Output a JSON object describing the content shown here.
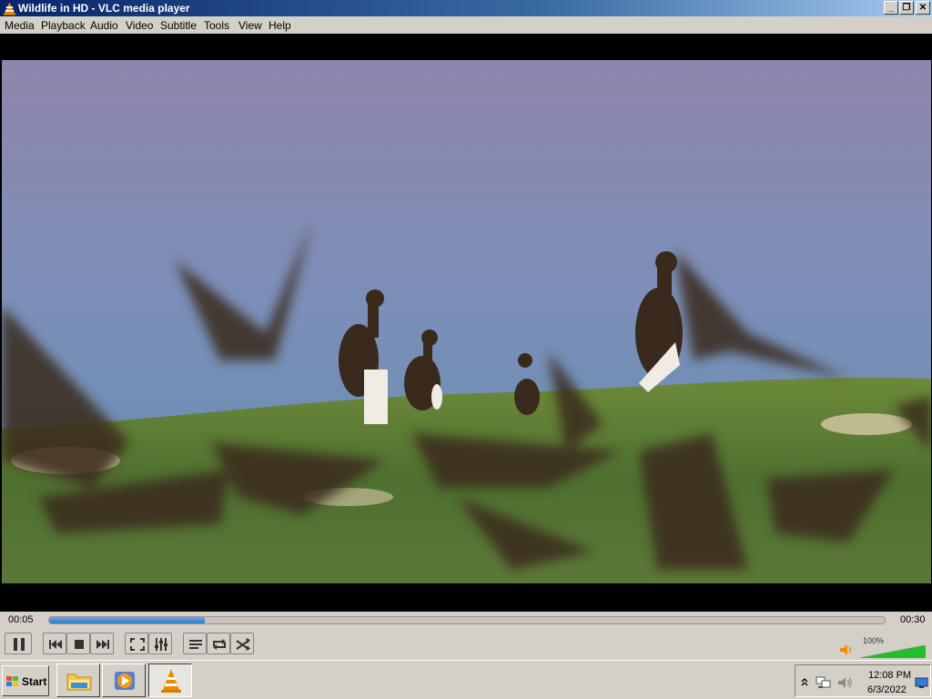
{
  "window": {
    "title": "Wildlife in HD - VLC media player",
    "minimize_glyph": "_",
    "restore_glyph": "❐",
    "close_glyph": "✕"
  },
  "menu": {
    "items": [
      "Media",
      "Playback",
      "Audio",
      "Video",
      "Subtitle",
      "Tools",
      "View",
      "Help"
    ]
  },
  "video": {
    "content": "birds-on-grassy-island-frame"
  },
  "playback": {
    "elapsed": "00:05",
    "total": "00:30",
    "progress_fraction": 0.186
  },
  "controls": {
    "icons": [
      "pause-icon",
      "previous-icon",
      "stop-icon",
      "next-icon",
      "fullscreen-icon",
      "extended-settings-icon",
      "playlist-icon",
      "loop-icon",
      "shuffle-icon"
    ],
    "volume_label": "100%",
    "volume_fraction": 1.0,
    "volume_color": "#21c02a"
  },
  "taskbar": {
    "start_label": "Start",
    "tasks": [
      "file-explorer-icon",
      "media-player-icon",
      "vlc-cone-icon"
    ],
    "active_task": "vlc-cone-icon",
    "tray_icons": [
      "show-hidden-icons-chevron",
      "network-icon",
      "speaker-icon",
      "show-desktop-icon"
    ],
    "time": "12:08 PM",
    "date": "6/3/2022"
  },
  "colors": {
    "accent": "#2f79cc",
    "chrome": "#d4d0c8",
    "vlc_orange": "#f08a00"
  }
}
